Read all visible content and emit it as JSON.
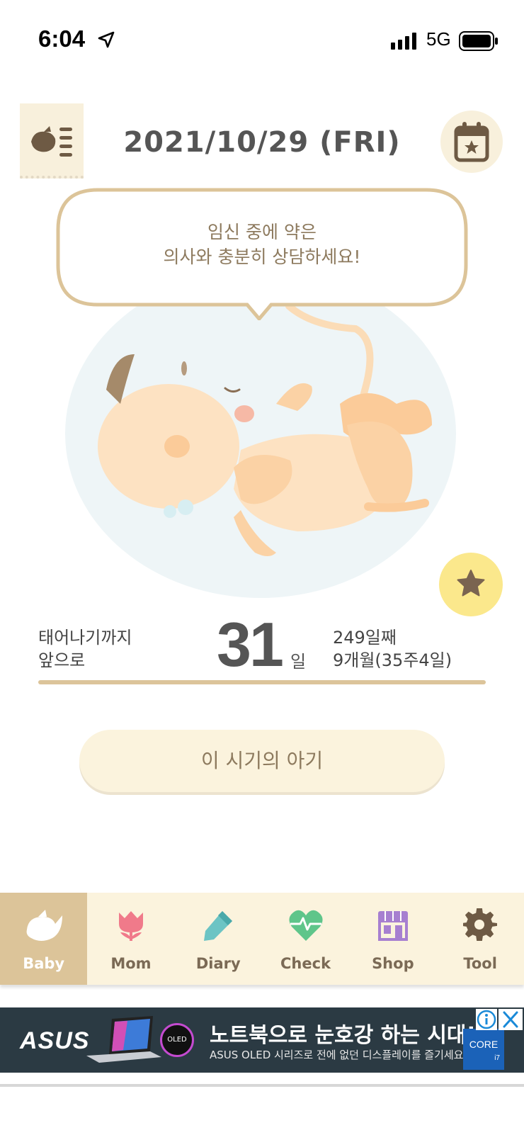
{
  "status_bar": {
    "time": "6:04",
    "network": "5G"
  },
  "header": {
    "date": "2021/10/29 (FRI)"
  },
  "bubble": {
    "line1": "임신 중에 약은",
    "line2": "의사와 충분히 상담하세요!"
  },
  "countdown": {
    "label_line1": "태어나기까지",
    "label_line2": "앞으로",
    "days": "31",
    "unit": "일",
    "elapsed": "249일째",
    "period": "9개월(35주4일)"
  },
  "baby_info_button": "이 시기의 아기",
  "nav": {
    "active": "Baby",
    "items": [
      {
        "label": "Baby",
        "icon": "bird-icon"
      },
      {
        "label": "Mom",
        "icon": "tulip-icon"
      },
      {
        "label": "Diary",
        "icon": "pen-icon"
      },
      {
        "label": "Check",
        "icon": "heartbeat-icon"
      },
      {
        "label": "Shop",
        "icon": "store-icon"
      },
      {
        "label": "Tool",
        "icon": "gear-icon"
      }
    ]
  },
  "ad": {
    "brand": "ASUS",
    "oled": "OLED",
    "headline": "노트북으로 눈호강 하는 시대!",
    "sub": "ASUS OLED 시리즈로 전에 없던 디스플레이를 즐기세요",
    "badge": "CORE",
    "badge_sub": "i7"
  },
  "colors": {
    "accent": "#dcc499",
    "cream": "#fbf3dd",
    "star": "#fbe88c",
    "text_brown": "#8d7a5e"
  }
}
